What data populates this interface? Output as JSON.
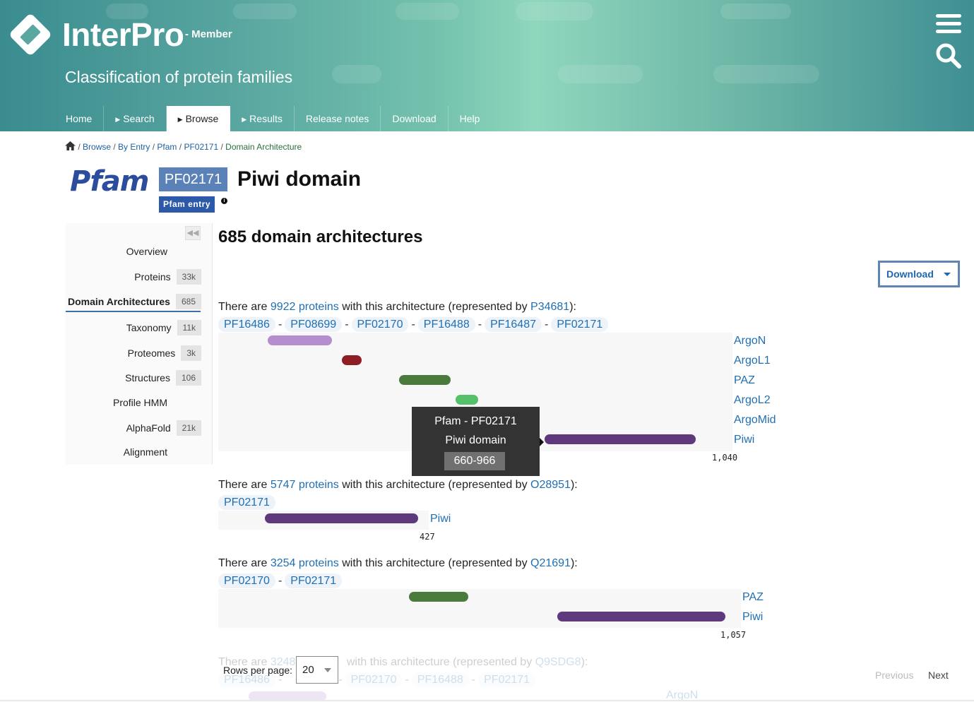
{
  "header": {
    "brand": "InterPro",
    "brand_sub": "- Member",
    "tagline": "Classification of protein families",
    "nav": [
      {
        "label": "Home",
        "caret": false,
        "active": false
      },
      {
        "label": "Search",
        "caret": true,
        "active": false
      },
      {
        "label": "Browse",
        "caret": true,
        "active": true
      },
      {
        "label": "Results",
        "caret": true,
        "active": false
      },
      {
        "label": "Release notes",
        "caret": false,
        "active": false
      },
      {
        "label": "Download",
        "caret": false,
        "active": false
      },
      {
        "label": "Help",
        "caret": false,
        "active": false
      }
    ]
  },
  "breadcrumb": {
    "items": [
      "Browse",
      "By Entry",
      "Pfam",
      "PF02171"
    ],
    "current": "Domain Architecture",
    "sep": " / "
  },
  "entry": {
    "db_logo": "Pfam",
    "accession": "PF02171",
    "name": "Piwi domain",
    "type_badge": "Pfam entry",
    "info_icon": "i"
  },
  "sidebar": {
    "items": [
      {
        "label": "Overview",
        "count": ""
      },
      {
        "label": "Proteins",
        "count": "33k"
      },
      {
        "label": "Domain Architectures",
        "count": "685",
        "active": true
      },
      {
        "label": "Taxonomy",
        "count": "11k"
      },
      {
        "label": "Proteomes",
        "count": "3k"
      },
      {
        "label": "Structures",
        "count": "106"
      },
      {
        "label": "Profile HMM",
        "count": ""
      },
      {
        "label": "AlphaFold",
        "count": "21k"
      },
      {
        "label": "Alignment",
        "count": ""
      }
    ]
  },
  "main": {
    "title": "685 domain architectures",
    "download_label": "Download",
    "text": {
      "there_are": "There are ",
      "with_arch": " with this architecture (represented by ",
      "close": "):"
    },
    "architectures": [
      {
        "count_link": "9922 proteins",
        "representative": "P34681",
        "domains": [
          "PF16486",
          "PF08699",
          "PF02170",
          "PF16488",
          "PF16487",
          "PF02171"
        ],
        "length": "1,040",
        "tracks": [
          {
            "label": "ArgoN",
            "color": "#b48ece",
            "start": 100,
            "end": 230
          },
          {
            "label": "ArgoL1",
            "color": "#8e1d24",
            "start": 250,
            "end": 290
          },
          {
            "label": "PAZ",
            "color": "#4b7a3d",
            "start": 365,
            "end": 470
          },
          {
            "label": "ArgoL2",
            "color": "#55c06a",
            "start": 480,
            "end": 525
          },
          {
            "label": "ArgoMid",
            "color": "#b48ece",
            "start": 0,
            "end": 0
          },
          {
            "label": "Piwi",
            "color": "#5e3a7d",
            "start": 660,
            "end": 966
          }
        ]
      },
      {
        "count_link": "5747 proteins",
        "representative": "O28951",
        "domains": [
          "PF02171"
        ],
        "length": "427",
        "tracks": [
          {
            "label": "Piwi",
            "color": "#5e3a7d",
            "start": 95,
            "end": 405
          }
        ]
      },
      {
        "count_link": "3254 proteins",
        "representative": "Q21691",
        "domains": [
          "PF02170",
          "PF02171"
        ],
        "length": "1,057",
        "tracks": [
          {
            "label": "PAZ",
            "color": "#4b7a3d",
            "start": 385,
            "end": 505
          },
          {
            "label": "Piwi",
            "color": "#5e3a7d",
            "start": 685,
            "end": 1025
          }
        ]
      },
      {
        "count_link": "3248",
        "representative": "Q9SDG8",
        "domains": [
          "PF16486",
          "",
          "PF02170",
          "PF16488",
          "PF02171"
        ],
        "length": "",
        "tracks": [
          {
            "label": "ArgoN",
            "color": "#b48ece",
            "start": 60,
            "end": 220
          }
        ]
      }
    ]
  },
  "tooltip": {
    "line1": "Pfam - PF02171",
    "line2": "Piwi domain",
    "range": "660-966"
  },
  "pager": {
    "rows_label": "Rows per page:",
    "rows_value": "20",
    "previous": "Previous",
    "next": "Next"
  },
  "icons": {
    "logo": "interpro-logo-icon",
    "menu": "hamburger-menu-icon",
    "search": "search-icon",
    "home": "home-icon",
    "collapse": "double-chevron-left-icon"
  },
  "colors": {
    "accent": "#1f6fb2",
    "badge": "#5a82b8",
    "badge_dark": "#2c59a8"
  }
}
